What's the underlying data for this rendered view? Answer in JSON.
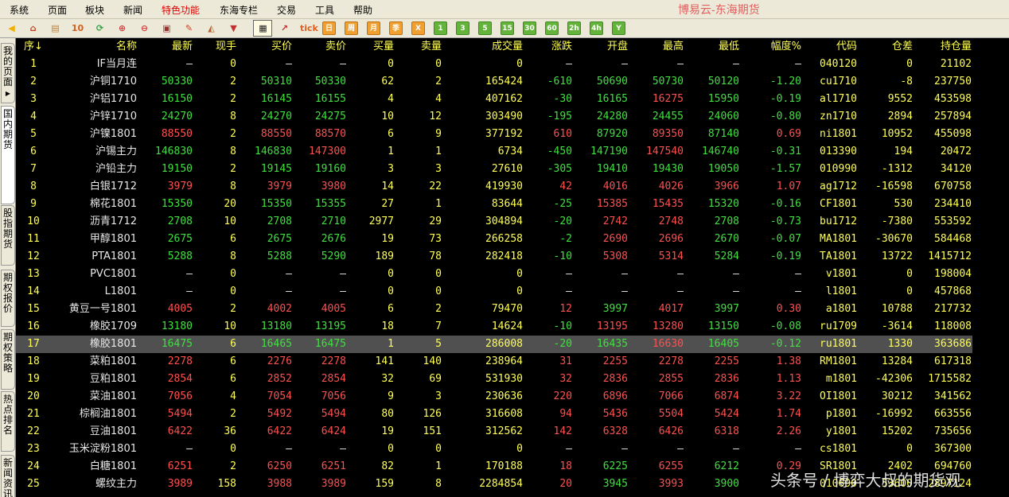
{
  "menu": [
    "系统",
    "页面",
    "板块",
    "新闻",
    "特色功能",
    "东海专栏",
    "交易",
    "工具",
    "帮助"
  ],
  "active_menu_index": 4,
  "app_title": "博易云-东海期货",
  "toolbar": {
    "buttons": [
      {
        "icon": "back-arrow-icon",
        "label": ""
      },
      {
        "icon": "home-icon",
        "label": ""
      },
      {
        "icon": "notepad-icon",
        "label": ""
      },
      {
        "icon": "tenday-icon",
        "label": "10"
      },
      {
        "icon": "refresh-icon",
        "label": ""
      },
      {
        "icon": "zoom-in-icon",
        "label": ""
      },
      {
        "icon": "zoom-out-icon",
        "label": ""
      },
      {
        "icon": "window-icon",
        "label": ""
      },
      {
        "icon": "pencil-icon",
        "label": ""
      },
      {
        "icon": "speaker-icon",
        "label": ""
      },
      {
        "icon": "filter-icon",
        "label": ""
      },
      {
        "icon": "quote-table-icon",
        "label": ""
      },
      {
        "icon": "trend-chart-icon",
        "label": ""
      },
      {
        "icon": "tick-icon",
        "label": "tick"
      },
      {
        "icon": "period-icon",
        "label": "日"
      },
      {
        "icon": "period-icon",
        "label": "周"
      },
      {
        "icon": "period-icon",
        "label": "月"
      },
      {
        "icon": "period-icon",
        "label": "季"
      },
      {
        "icon": "period-icon",
        "label": "X"
      },
      {
        "icon": "period-icon",
        "label": "1"
      },
      {
        "icon": "period-icon",
        "label": "3"
      },
      {
        "icon": "period-icon",
        "label": "5"
      },
      {
        "icon": "period-icon",
        "label": "15"
      },
      {
        "icon": "period-icon",
        "label": "30"
      },
      {
        "icon": "period-icon",
        "label": "60"
      },
      {
        "icon": "period-icon",
        "label": "2h"
      },
      {
        "icon": "period-icon",
        "label": "4h"
      },
      {
        "icon": "period-icon",
        "label": "Y"
      }
    ]
  },
  "side_tabs": [
    {
      "label": "我的页面",
      "active": false
    },
    {
      "label": "国内期货",
      "active": true
    },
    {
      "label": "股指期货",
      "active": false
    },
    {
      "label": "期权报价",
      "active": false
    },
    {
      "label": "期权策略",
      "active": false
    },
    {
      "label": "热点排名",
      "active": false
    },
    {
      "label": "新闻资讯",
      "active": false
    }
  ],
  "columns": [
    "序↓",
    "名称",
    "最新",
    "现手",
    "买价",
    "卖价",
    "买量",
    "卖量",
    "成交量",
    "涨跌",
    "开盘",
    "最高",
    "最低",
    "幅度%",
    "代码",
    "仓差",
    "持仓量"
  ],
  "colors": {
    "up": "#ff5050",
    "down": "#40e040",
    "neutral": "#ffff55",
    "name": "#e8e8e8",
    "selected_row": "#505050"
  },
  "selected_row_index": 16,
  "rows": [
    {
      "seq": "1",
      "name": "IF当月连",
      "last": "—",
      "vol": "0",
      "bid": "—",
      "ask": "—",
      "bidv": "0",
      "askv": "0",
      "total": "0",
      "chg": "—",
      "open": "—",
      "high": "—",
      "low": "—",
      "pct": "—",
      "code": "040120",
      "oichg": "0",
      "oi": "21102",
      "tr": "n",
      "hc": "n",
      "lc": "n"
    },
    {
      "seq": "2",
      "name": "沪铜1710",
      "last": "50330",
      "vol": "2",
      "bid": "50310",
      "ask": "50330",
      "bidv": "62",
      "askv": "2",
      "total": "165424",
      "chg": "-610",
      "open": "50690",
      "high": "50730",
      "low": "50120",
      "pct": "-1.20",
      "code": "cu1710",
      "oichg": "-8",
      "oi": "237750",
      "tr": "d",
      "hc": "d",
      "lc": "d",
      "oc": "d"
    },
    {
      "seq": "3",
      "name": "沪铝1710",
      "last": "16150",
      "vol": "2",
      "bid": "16145",
      "ask": "16155",
      "bidv": "4",
      "askv": "4",
      "total": "407162",
      "chg": "-30",
      "open": "16165",
      "high": "16275",
      "low": "15950",
      "pct": "-0.19",
      "code": "al1710",
      "oichg": "9552",
      "oi": "453598",
      "tr": "d",
      "hc": "u",
      "lc": "d",
      "oc": "d"
    },
    {
      "seq": "4",
      "name": "沪锌1710",
      "last": "24270",
      "vol": "8",
      "bid": "24270",
      "ask": "24275",
      "bidv": "10",
      "askv": "12",
      "total": "303490",
      "chg": "-195",
      "open": "24280",
      "high": "24455",
      "low": "24060",
      "pct": "-0.80",
      "code": "zn1710",
      "oichg": "2894",
      "oi": "257894",
      "tr": "d",
      "hc": "d",
      "lc": "d",
      "oc": "d"
    },
    {
      "seq": "5",
      "name": "沪镍1801",
      "last": "88550",
      "vol": "2",
      "bid": "88550",
      "ask": "88570",
      "bidv": "6",
      "askv": "9",
      "total": "377192",
      "chg": "610",
      "open": "87920",
      "high": "89350",
      "low": "87140",
      "pct": "0.69",
      "code": "ni1801",
      "oichg": "10952",
      "oi": "455098",
      "tr": "u",
      "hc": "u",
      "lc": "d",
      "oc": "d"
    },
    {
      "seq": "6",
      "name": "沪锡主力",
      "last": "146830",
      "vol": "8",
      "bid": "146830",
      "ask": "147300",
      "bidv": "1",
      "askv": "1",
      "total": "6734",
      "chg": "-450",
      "open": "147190",
      "high": "147540",
      "low": "146740",
      "pct": "-0.31",
      "code": "013390",
      "oichg": "194",
      "oi": "20472",
      "tr": "d",
      "hc": "u",
      "lc": "d",
      "oc": "d",
      "ac": "u"
    },
    {
      "seq": "7",
      "name": "沪铅主力",
      "last": "19150",
      "vol": "2",
      "bid": "19145",
      "ask": "19160",
      "bidv": "3",
      "askv": "3",
      "total": "27610",
      "chg": "-305",
      "open": "19410",
      "high": "19430",
      "low": "19050",
      "pct": "-1.57",
      "code": "010990",
      "oichg": "-1312",
      "oi": "34120",
      "tr": "d",
      "hc": "d",
      "lc": "d",
      "oc": "d"
    },
    {
      "seq": "8",
      "name": "白银1712",
      "last": "3979",
      "vol": "8",
      "bid": "3979",
      "ask": "3980",
      "bidv": "14",
      "askv": "22",
      "total": "419930",
      "chg": "42",
      "open": "4016",
      "high": "4026",
      "low": "3966",
      "pct": "1.07",
      "code": "ag1712",
      "oichg": "-16598",
      "oi": "670758",
      "tr": "u",
      "hc": "u",
      "lc": "u",
      "oc": "u"
    },
    {
      "seq": "9",
      "name": "棉花1801",
      "last": "15350",
      "vol": "20",
      "bid": "15350",
      "ask": "15355",
      "bidv": "27",
      "askv": "1",
      "total": "83644",
      "chg": "-25",
      "open": "15385",
      "high": "15435",
      "low": "15320",
      "pct": "-0.16",
      "code": "CF1801",
      "oichg": "530",
      "oi": "234410",
      "tr": "d",
      "hc": "u",
      "lc": "d",
      "oc": "u"
    },
    {
      "seq": "10",
      "name": "沥青1712",
      "last": "2708",
      "vol": "10",
      "bid": "2708",
      "ask": "2710",
      "bidv": "2977",
      "askv": "29",
      "total": "304894",
      "chg": "-20",
      "open": "2742",
      "high": "2748",
      "low": "2708",
      "pct": "-0.73",
      "code": "bu1712",
      "oichg": "-7380",
      "oi": "553592",
      "tr": "d",
      "hc": "u",
      "lc": "d",
      "oc": "u"
    },
    {
      "seq": "11",
      "name": "甲醇1801",
      "last": "2675",
      "vol": "6",
      "bid": "2675",
      "ask": "2676",
      "bidv": "19",
      "askv": "73",
      "total": "266258",
      "chg": "-2",
      "open": "2690",
      "high": "2696",
      "low": "2670",
      "pct": "-0.07",
      "code": "MA1801",
      "oichg": "-30670",
      "oi": "584468",
      "tr": "d",
      "hc": "u",
      "lc": "d",
      "oc": "u"
    },
    {
      "seq": "12",
      "name": "PTA1801",
      "last": "5288",
      "vol": "8",
      "bid": "5288",
      "ask": "5290",
      "bidv": "189",
      "askv": "78",
      "total": "282418",
      "chg": "-10",
      "open": "5308",
      "high": "5314",
      "low": "5284",
      "pct": "-0.19",
      "code": "TA1801",
      "oichg": "13722",
      "oi": "1415712",
      "tr": "d",
      "hc": "u",
      "lc": "d",
      "oc": "u"
    },
    {
      "seq": "13",
      "name": "PVC1801",
      "last": "—",
      "vol": "0",
      "bid": "—",
      "ask": "—",
      "bidv": "0",
      "askv": "0",
      "total": "0",
      "chg": "—",
      "open": "—",
      "high": "—",
      "low": "—",
      "pct": "—",
      "code": "v1801",
      "oichg": "0",
      "oi": "198004",
      "tr": "n",
      "hc": "n",
      "lc": "n"
    },
    {
      "seq": "14",
      "name": "L1801",
      "last": "—",
      "vol": "0",
      "bid": "—",
      "ask": "—",
      "bidv": "0",
      "askv": "0",
      "total": "0",
      "chg": "—",
      "open": "—",
      "high": "—",
      "low": "—",
      "pct": "—",
      "code": "l1801",
      "oichg": "0",
      "oi": "457868",
      "tr": "n",
      "hc": "n",
      "lc": "n"
    },
    {
      "seq": "15",
      "name": "黄豆一号1801",
      "last": "4005",
      "vol": "2",
      "bid": "4002",
      "ask": "4005",
      "bidv": "6",
      "askv": "2",
      "total": "79470",
      "chg": "12",
      "open": "3997",
      "high": "4017",
      "low": "3997",
      "pct": "0.30",
      "code": "a1801",
      "oichg": "10788",
      "oi": "217732",
      "tr": "u",
      "hc": "u",
      "lc": "d",
      "oc": "d"
    },
    {
      "seq": "16",
      "name": "橡胶1709",
      "last": "13180",
      "vol": "10",
      "bid": "13180",
      "ask": "13195",
      "bidv": "18",
      "askv": "7",
      "total": "14624",
      "chg": "-10",
      "open": "13195",
      "high": "13280",
      "low": "13150",
      "pct": "-0.08",
      "code": "ru1709",
      "oichg": "-3614",
      "oi": "118008",
      "tr": "d",
      "hc": "u",
      "lc": "d",
      "oc": "u"
    },
    {
      "seq": "17",
      "name": "橡胶1801",
      "last": "16475",
      "vol": "6",
      "bid": "16465",
      "ask": "16475",
      "bidv": "1",
      "askv": "5",
      "total": "286008",
      "chg": "-20",
      "open": "16435",
      "high": "16630",
      "low": "16405",
      "pct": "-0.12",
      "code": "ru1801",
      "oichg": "1330",
      "oi": "363686",
      "tr": "d",
      "hc": "u",
      "lc": "d",
      "oc": "d"
    },
    {
      "seq": "18",
      "name": "菜粕1801",
      "last": "2278",
      "vol": "6",
      "bid": "2276",
      "ask": "2278",
      "bidv": "141",
      "askv": "140",
      "total": "238964",
      "chg": "31",
      "open": "2255",
      "high": "2278",
      "low": "2255",
      "pct": "1.38",
      "code": "RM1801",
      "oichg": "13284",
      "oi": "617318",
      "tr": "u",
      "hc": "u",
      "lc": "u",
      "oc": "u"
    },
    {
      "seq": "19",
      "name": "豆粕1801",
      "last": "2854",
      "vol": "6",
      "bid": "2852",
      "ask": "2854",
      "bidv": "32",
      "askv": "69",
      "total": "531930",
      "chg": "32",
      "open": "2836",
      "high": "2855",
      "low": "2836",
      "pct": "1.13",
      "code": "m1801",
      "oichg": "-42306",
      "oi": "1715582",
      "tr": "u",
      "hc": "u",
      "lc": "u",
      "oc": "u"
    },
    {
      "seq": "20",
      "name": "菜油1801",
      "last": "7056",
      "vol": "4",
      "bid": "7054",
      "ask": "7056",
      "bidv": "9",
      "askv": "3",
      "total": "230636",
      "chg": "220",
      "open": "6896",
      "high": "7066",
      "low": "6874",
      "pct": "3.22",
      "code": "OI1801",
      "oichg": "30212",
      "oi": "341562",
      "tr": "u",
      "hc": "u",
      "lc": "u",
      "oc": "u"
    },
    {
      "seq": "21",
      "name": "棕榈油1801",
      "last": "5494",
      "vol": "2",
      "bid": "5492",
      "ask": "5494",
      "bidv": "80",
      "askv": "126",
      "total": "316608",
      "chg": "94",
      "open": "5436",
      "high": "5504",
      "low": "5424",
      "pct": "1.74",
      "code": "p1801",
      "oichg": "-16992",
      "oi": "663556",
      "tr": "u",
      "hc": "u",
      "lc": "u",
      "oc": "u"
    },
    {
      "seq": "22",
      "name": "豆油1801",
      "last": "6422",
      "vol": "36",
      "bid": "6422",
      "ask": "6424",
      "bidv": "19",
      "askv": "151",
      "total": "312562",
      "chg": "142",
      "open": "6328",
      "high": "6426",
      "low": "6318",
      "pct": "2.26",
      "code": "y1801",
      "oichg": "15202",
      "oi": "735656",
      "tr": "u",
      "hc": "u",
      "lc": "u",
      "oc": "u"
    },
    {
      "seq": "23",
      "name": "玉米淀粉1801",
      "last": "—",
      "vol": "0",
      "bid": "—",
      "ask": "—",
      "bidv": "0",
      "askv": "0",
      "total": "0",
      "chg": "—",
      "open": "—",
      "high": "—",
      "low": "—",
      "pct": "—",
      "code": "cs1801",
      "oichg": "0",
      "oi": "367300",
      "tr": "n",
      "hc": "n",
      "lc": "n"
    },
    {
      "seq": "24",
      "name": "白糖1801",
      "last": "6251",
      "vol": "2",
      "bid": "6250",
      "ask": "6251",
      "bidv": "82",
      "askv": "1",
      "total": "170188",
      "chg": "18",
      "open": "6225",
      "high": "6255",
      "low": "6212",
      "pct": "0.29",
      "code": "SR1801",
      "oichg": "2402",
      "oi": "694760",
      "tr": "u",
      "hc": "u",
      "lc": "d",
      "oc": "d"
    },
    {
      "seq": "25",
      "name": "螺纹主力",
      "last": "3989",
      "vol": "158",
      "bid": "3988",
      "ask": "3989",
      "bidv": "159",
      "askv": "8",
      "total": "2284854",
      "chg": "20",
      "open": "3945",
      "high": "3993",
      "low": "3900",
      "pct": "",
      "code": "010690",
      "oichg": "53600",
      "oi": "2897124",
      "tr": "u",
      "hc": "u",
      "lc": "d",
      "oc": "d"
    }
  ],
  "watermark": "头条号 / 博弈大叔的期货观"
}
